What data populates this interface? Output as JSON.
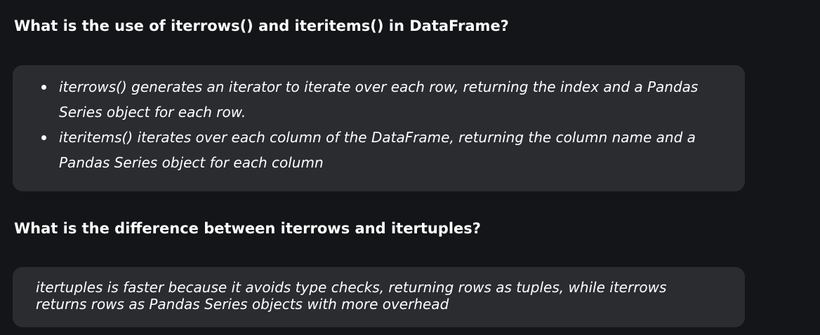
{
  "qa": [
    {
      "question": "What is the use of iterrows() and iteritems() in DataFrame?",
      "answer_bullets": [
        "iterrows() generates an iterator to iterate over each row, returning the index and a Pandas Series object for each row.",
        "iteritems() iterates over each column of the DataFrame, returning the column name and a Pandas Series object for each column"
      ]
    },
    {
      "question": "What is the difference between iterrows and itertuples?",
      "answer_text": "itertuples is faster because it avoids type checks, returning rows as tuples, while iterrows returns rows as Pandas Series objects with more overhead"
    }
  ]
}
